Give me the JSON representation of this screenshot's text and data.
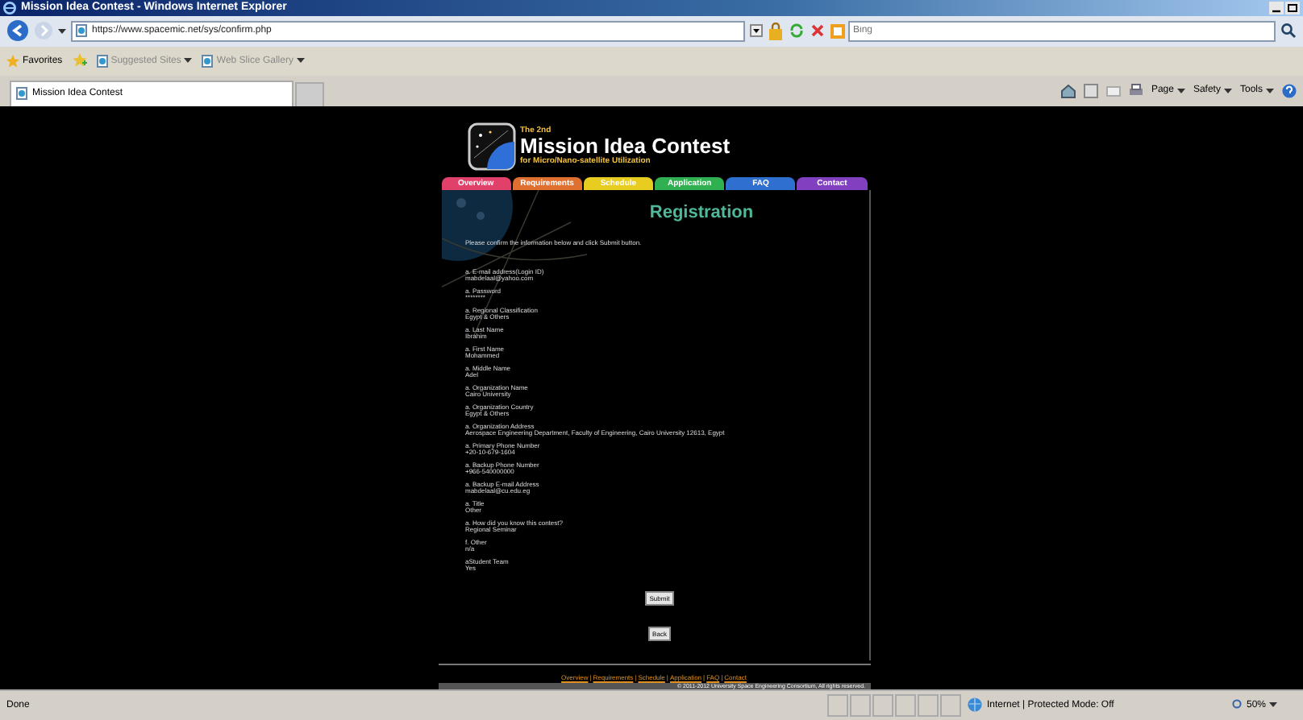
{
  "window": {
    "title": "Mission Idea Contest - Windows Internet Explorer"
  },
  "address_bar": {
    "url": "https://www.spacemic.net/sys/confirm.php"
  },
  "search": {
    "placeholder": "Bing"
  },
  "favorites_bar": {
    "label": "Favorites",
    "items": [
      "Suggested Sites",
      "Web Slice Gallery"
    ]
  },
  "tabs": [
    {
      "label": "Mission Idea Contest",
      "selected": true
    }
  ],
  "command_bar": [
    "Page",
    "Safety",
    "Tools"
  ],
  "site": {
    "pre_title": "The 2nd",
    "title": "Mission Idea Contest",
    "subtitle": "for Micro/Nano-satellite Utilization",
    "nav": [
      {
        "label": "Overview",
        "color": "#e0406a"
      },
      {
        "label": "Requirements",
        "color": "#e07030"
      },
      {
        "label": "Schedule",
        "color": "#e8cc20"
      },
      {
        "label": "Application",
        "color": "#30b050"
      },
      {
        "label": "FAQ",
        "color": "#2f6fd0"
      },
      {
        "label": "Contact",
        "color": "#8040c0"
      }
    ],
    "heading": "Registration",
    "intro": "Please confirm the information below and click Submit button.",
    "fields": [
      {
        "label": "a. E-mail address(Login ID)",
        "value": "mabdelaal@yahoo.com"
      },
      {
        "label": "a. Password",
        "value": "********"
      },
      {
        "label": "a. Regional Classification",
        "value": "Egypt & Others"
      },
      {
        "label": "a. Last Name",
        "value": "Ibrahim"
      },
      {
        "label": "a. First Name",
        "value": "Mohammed"
      },
      {
        "label": "a. Middle Name",
        "value": "Adel"
      },
      {
        "label": "a. Organization Name",
        "value": "Cairo University"
      },
      {
        "label": "a. Organization Country",
        "value": "Egypt & Others"
      },
      {
        "label": "a. Organization Address",
        "value": "Aerospace Engineering Department, Faculty of Engineering, Cairo University 12613, Egypt"
      },
      {
        "label": "a. Primary Phone Number",
        "value": "+20-10-679-1604"
      },
      {
        "label": "a. Backup Phone Number",
        "value": "+966-540000000"
      },
      {
        "label": "a. Backup E-mail Address",
        "value": "mabdelaal@cu.edu.eg"
      },
      {
        "label": "a. Title",
        "value": "Other"
      },
      {
        "label": "a. How did you know this contest?",
        "value": "Regional Seminar"
      },
      {
        "label": "f. Other",
        "value": "n/a"
      },
      {
        "label": "aStudent Team",
        "value": "Yes"
      }
    ],
    "buttons": [
      "Submit",
      "Back"
    ],
    "footer_separator": "|",
    "footer_links": [
      "Overview",
      "Requirements",
      "Schedule",
      "Application",
      "FAQ",
      "Contact"
    ],
    "copyright": "© 2011-2012 University Space Engineering Consortium, All rights reserved."
  },
  "status_bar": {
    "text": "Done",
    "zone": "Internet | Protected Mode: Off",
    "zoom": "50%"
  }
}
